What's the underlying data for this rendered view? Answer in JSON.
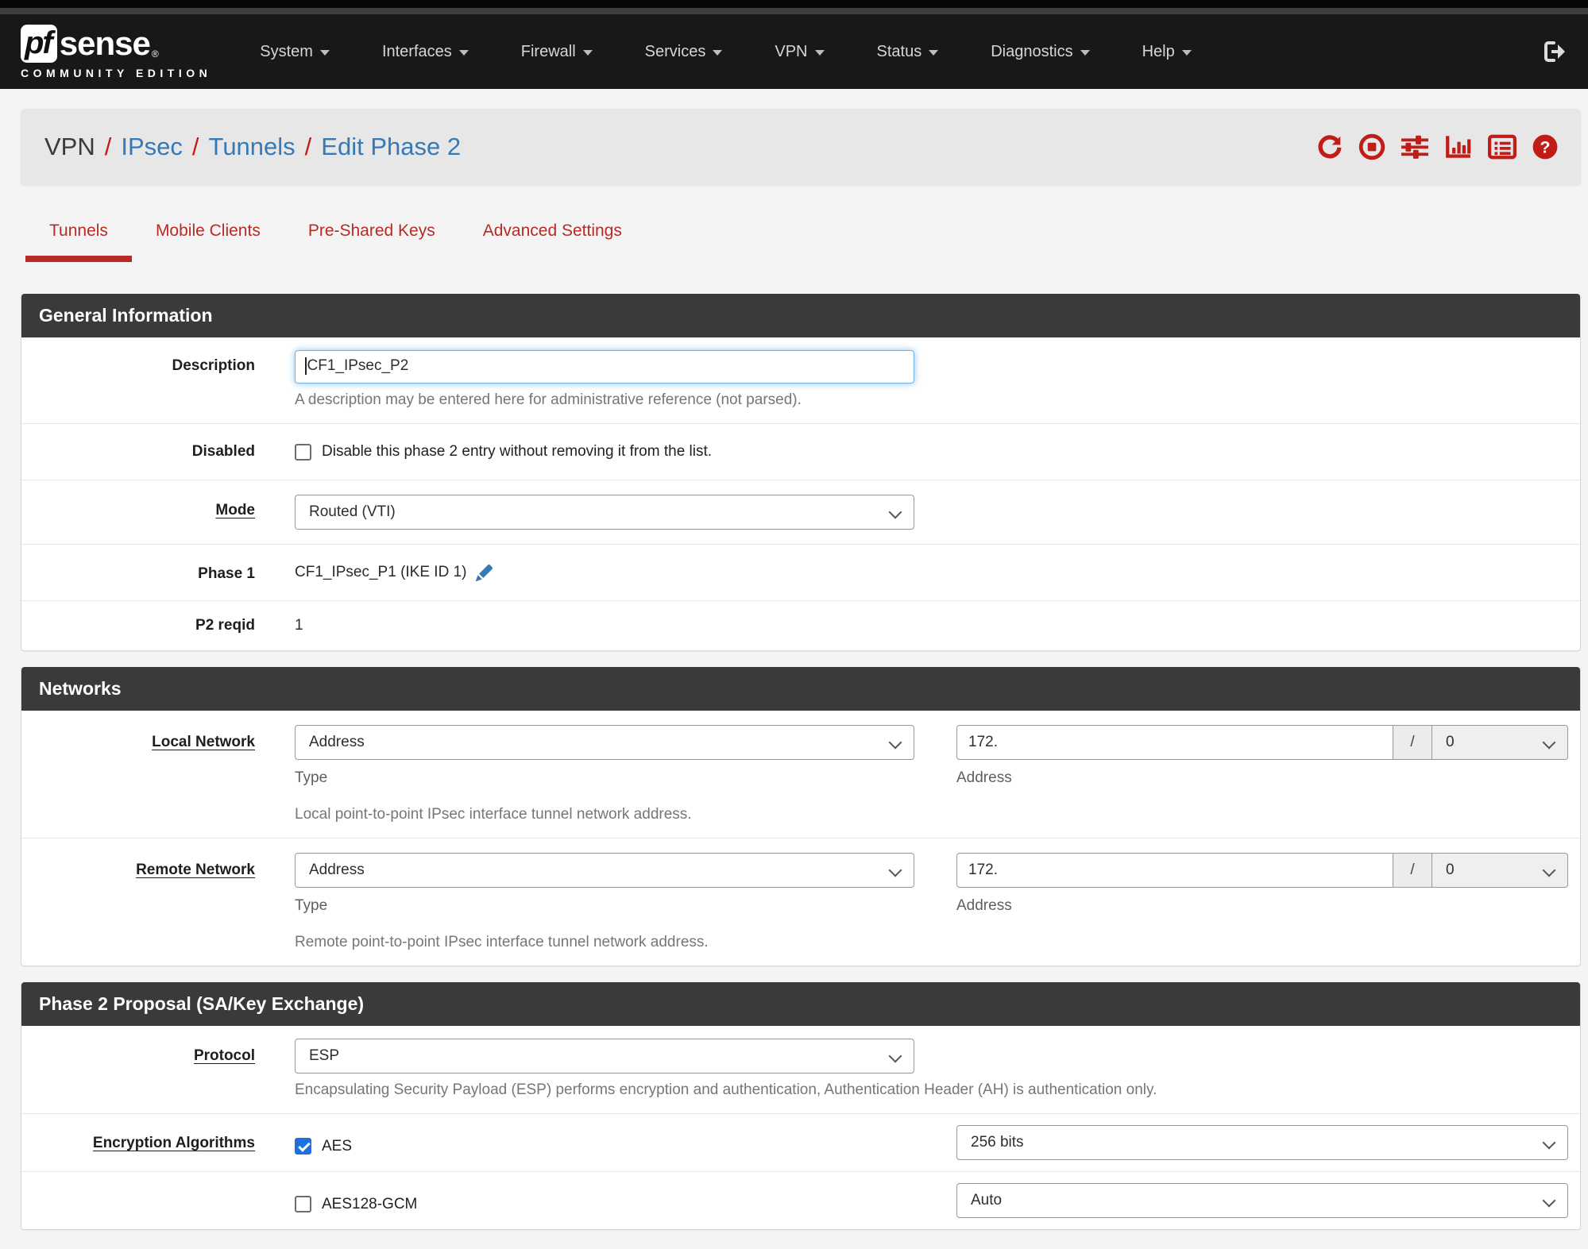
{
  "colors": {
    "accent_red": "#b72b25",
    "icon_red": "#c11d18",
    "link_blue": "#3579b8",
    "navbar_bg": "#181818",
    "panel_header_bg": "#3a3a3a",
    "focus_blue": "#6db3ea",
    "checkbox_blue": "#1d70e0"
  },
  "navbar": {
    "brand": {
      "pf": "pf",
      "sense": "sense",
      "reg": "®",
      "subtitle": "COMMUNITY EDITION"
    },
    "items": [
      {
        "label": "System"
      },
      {
        "label": "Interfaces"
      },
      {
        "label": "Firewall"
      },
      {
        "label": "Services"
      },
      {
        "label": "VPN"
      },
      {
        "label": "Status"
      },
      {
        "label": "Diagnostics"
      },
      {
        "label": "Help"
      }
    ],
    "logout_icon": "sign-out-icon"
  },
  "breadcrumb": {
    "root": "VPN",
    "sep": "/",
    "links": [
      "IPsec",
      "Tunnels",
      "Edit Phase 2"
    ],
    "icons": [
      "refresh-icon",
      "stop-circle-icon",
      "sliders-icon",
      "chart-bar-icon",
      "log-list-icon",
      "help-circle-icon"
    ]
  },
  "tabs": [
    {
      "label": "Tunnels",
      "active": true
    },
    {
      "label": "Mobile Clients",
      "active": false
    },
    {
      "label": "Pre-Shared Keys",
      "active": false
    },
    {
      "label": "Advanced Settings",
      "active": false
    }
  ],
  "general": {
    "header": "General Information",
    "description": {
      "label": "Description",
      "value": "CF1_IPsec_P2",
      "help": "A description may be entered here for administrative reference (not parsed)."
    },
    "disabled": {
      "label": "Disabled",
      "checkbox_label": "Disable this phase 2 entry without removing it from the list.",
      "checked": false
    },
    "mode": {
      "label": "Mode",
      "value": "Routed (VTI)"
    },
    "phase1": {
      "label": "Phase 1",
      "value": "CF1_IPsec_P1 (IKE ID 1)",
      "edit_icon": "pencil-icon"
    },
    "p2reqid": {
      "label": "P2 reqid",
      "value": "1"
    }
  },
  "networks": {
    "header": "Networks",
    "local": {
      "label": "Local Network",
      "type_value": "Address",
      "type_caption": "Type",
      "address_value": "172.",
      "address_caption": "Address",
      "slash": "/",
      "prefix_value": "0",
      "help": "Local point-to-point IPsec interface tunnel network address."
    },
    "remote": {
      "label": "Remote Network",
      "type_value": "Address",
      "type_caption": "Type",
      "address_value": "172.",
      "address_caption": "Address",
      "slash": "/",
      "prefix_value": "0",
      "help": "Remote point-to-point IPsec interface tunnel network address."
    }
  },
  "proposal": {
    "header": "Phase 2 Proposal (SA/Key Exchange)",
    "protocol": {
      "label": "Protocol",
      "value": "ESP",
      "help": "Encapsulating Security Payload (ESP) performs encryption and authentication, Authentication Header (AH) is authentication only."
    },
    "encryption": {
      "label": "Encryption Algorithms",
      "rows": [
        {
          "checked": true,
          "algo": "AES",
          "keylen": "256 bits"
        },
        {
          "checked": false,
          "algo": "AES128-GCM",
          "keylen": "Auto"
        }
      ]
    }
  }
}
